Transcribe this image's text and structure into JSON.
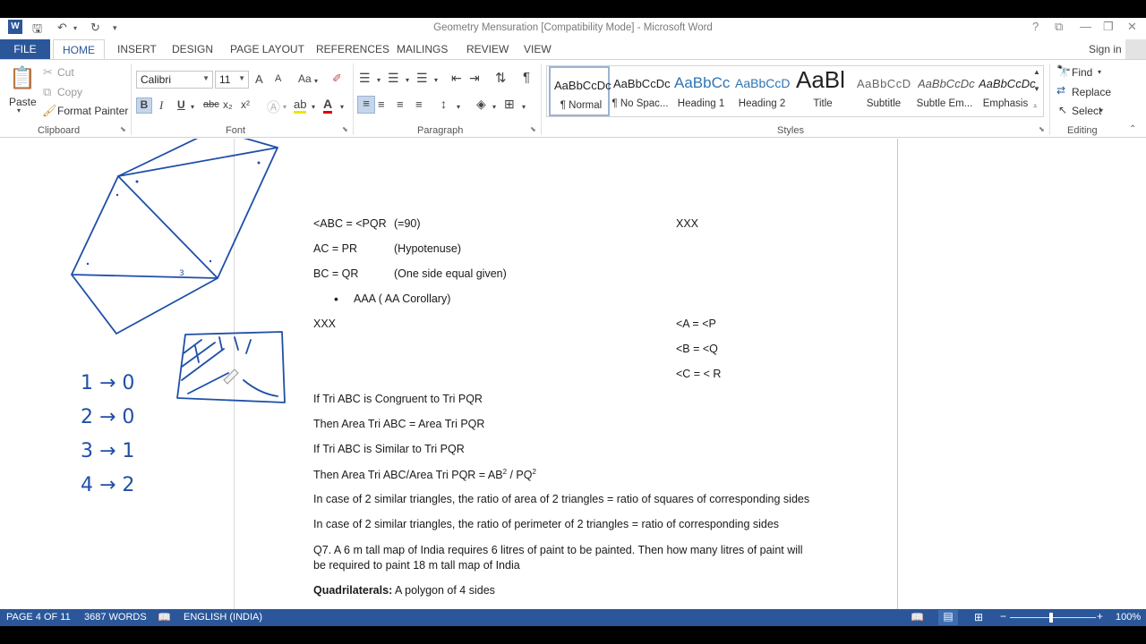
{
  "window": {
    "title": "Geometry Mensuration [Compatibility Mode] - Microsoft Word",
    "help": "?",
    "restore_ribbon": "⧉",
    "minimize": "—",
    "maximize": "❐",
    "close": "✕"
  },
  "tabs": {
    "file": "FILE",
    "home": "HOME",
    "insert": "INSERT",
    "design": "DESIGN",
    "page_layout": "PAGE LAYOUT",
    "references": "REFERENCES",
    "mailings": "MAILINGS",
    "review": "REVIEW",
    "view": "VIEW",
    "sign_in": "Sign in"
  },
  "clipboard": {
    "paste": "Paste",
    "cut": "Cut",
    "copy": "Copy",
    "format_painter": "Format Painter",
    "label": "Clipboard"
  },
  "font": {
    "name": "Calibri",
    "size": "11",
    "label": "Font",
    "bold": "B",
    "italic": "I",
    "underline": "U",
    "strike": "abc",
    "subscript": "x₂",
    "superscript": "x²",
    "change_case": "Aa",
    "grow": "A",
    "shrink": "A"
  },
  "paragraph": {
    "label": "Paragraph",
    "pilcrow": "¶"
  },
  "styles": {
    "label": "Styles",
    "items": [
      {
        "sample": "AaBbCcDc",
        "name": "¶ Normal"
      },
      {
        "sample": "AaBbCcDc",
        "name": "¶ No Spac..."
      },
      {
        "sample": "AaBbCc",
        "name": "Heading 1"
      },
      {
        "sample": "AaBbCcD",
        "name": "Heading 2"
      },
      {
        "sample": "AaBl",
        "name": "Title"
      },
      {
        "sample": "AaBbCcD",
        "name": "Subtitle"
      },
      {
        "sample": "AaBbCcDc",
        "name": "Subtle Em..."
      },
      {
        "sample": "AaBbCcDc",
        "name": "Emphasis"
      }
    ]
  },
  "editing": {
    "label": "Editing",
    "find": "Find",
    "replace": "Replace",
    "select": "Select"
  },
  "document": {
    "r1_a": "<ABC = <PQR",
    "r1_b": "(=90)",
    "r1_c": "XXX",
    "r2_a": "AC = PR",
    "r2_b": "(Hypotenuse)",
    "r3_a": "BC = QR",
    "r3_b": "(One side equal given)",
    "bullet": "AAA ( AA Corollary)",
    "r5_a": "XXX",
    "r5_c": "<A = <P",
    "r6_c": "<B = <Q",
    "r7_c": "<C = < R",
    "l1": "If Tri ABC is Congruent to Tri PQR",
    "l2": "Then Area Tri ABC = Area Tri PQR",
    "l3": "If Tri ABC is Similar to Tri PQR",
    "l4_pre": "Then Area Tri ABC/Area Tri PQR = AB",
    "l4_mid": " / PQ",
    "l4_sup": "2",
    "l5": "In case of 2 similar triangles, the ratio of area of 2 triangles = ratio of squares of corresponding sides",
    "l6": "In case of 2 similar triangles, the ratio of perimeter of 2 triangles = ratio of corresponding sides",
    "q7_line1": "Q7. A 6 m tall map of India requires 6 litres of paint to be painted. Then how many litres of paint will",
    "q7_line2": "be required to paint 18 m tall map of India",
    "quad_bold": "Quadrilaterals:",
    "quad_rest": " A polygon of 4 sides"
  },
  "ink": {
    "color": "#1f4fa8",
    "lines": [
      "1 → 0",
      "2 → 0",
      "3 → 1",
      "4 → 2"
    ]
  },
  "status": {
    "page": "PAGE 4 OF 11",
    "words": "3687 WORDS",
    "language": "ENGLISH (INDIA)",
    "zoom": "100%"
  }
}
